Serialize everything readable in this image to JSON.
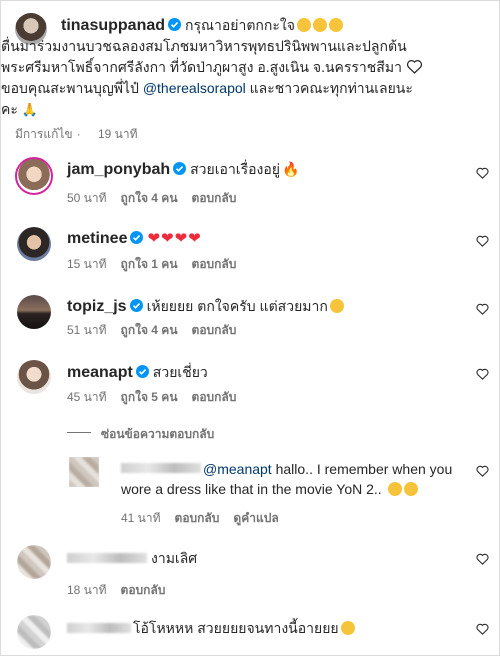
{
  "post": {
    "username": "tinasuppanad",
    "caption_line1_tail": "กรุณาอย่าตกกะใจ",
    "caption_line2": "ตื่นมาร่วมงานบวชฉลองสมโภชมหาวิหารพุทธปรินิพพานและปลูกต้น",
    "caption_line3": "พระศรีมหาโพธิ์จากศรีลังกา ที่วัดป่าภูผาสูง อ.สูงเนิน จ.นครราชสีมา",
    "caption_line4_head": "ขอบคุณสะพานบุญพี่ไป๋",
    "caption_mention": "@therealsorapol",
    "caption_line4_tail": "และชาวคณะทุกท่านเลยนะ",
    "caption_line5": "คะ",
    "edited_label": "มีการแก้ไข",
    "time": "19 นาที"
  },
  "comments": [
    {
      "username": "jam_ponybah",
      "text": "สวยเอาเรื่องอยู่",
      "time": "50 นาที",
      "likes": "ถูกใจ 4 คน",
      "reply": "ตอบกลับ"
    },
    {
      "username": "metinee",
      "text": "",
      "time": "15 นาที",
      "likes": "ถูกใจ 1 คน",
      "reply": "ตอบกลับ"
    },
    {
      "username": "topiz_js",
      "text": "เห้ยยยย ตกใจครับ แต่สวยมาก",
      "time": "51 นาที",
      "likes": "ถูกใจ 4 คน",
      "reply": "ตอบกลับ"
    },
    {
      "username": "meanapt",
      "text": "สวยเชี่ยว",
      "time": "45 นาที",
      "likes": "ถูกใจ 5 คน",
      "reply": "ตอบกลับ"
    }
  ],
  "hide_replies_label": "ซ่อนข้อความตอบกลับ",
  "reply": {
    "mention": "@meanapt",
    "text_line1": "hallo.. I remember when you",
    "text_line2": "wore a dress like that in the movie YoN 2..",
    "time": "41 นาที",
    "reply_label": "ตอบกลับ",
    "translate_label": "ดูคำแปล"
  },
  "other_comments": [
    {
      "text": "งามเลิศ",
      "time": "18 นาที",
      "reply": "ตอบกลับ"
    },
    {
      "text": "โอ้โหหหห สวยยยยจนทางนี้อายยย"
    }
  ],
  "colors": {
    "verified": "#0095f6",
    "heart_red": "#ed4956",
    "link": "#00376b",
    "meta": "#737373"
  }
}
